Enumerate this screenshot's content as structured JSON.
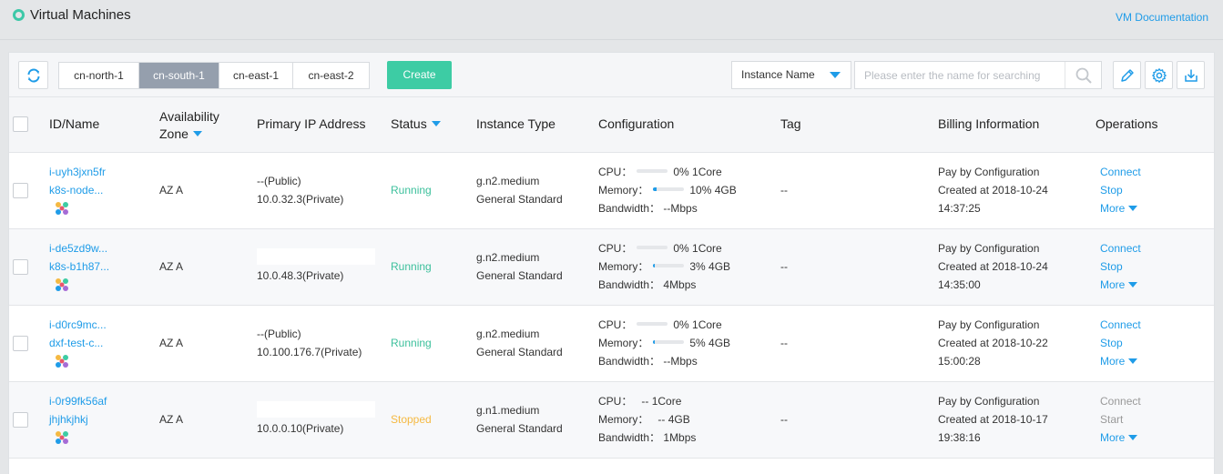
{
  "header": {
    "title": "Virtual Machines",
    "doc_link": "VM Documentation"
  },
  "toolbar": {
    "regions": [
      "cn-north-1",
      "cn-south-1",
      "cn-east-1",
      "cn-east-2"
    ],
    "active_region": "cn-south-1",
    "create_label": "Create",
    "search_type": "Instance Name",
    "search_placeholder": "Please enter the name for searching"
  },
  "table": {
    "columns": {
      "id_name": "ID/Name",
      "az_line1": "Availability",
      "az_line2": "Zone",
      "ip": "Primary IP Address",
      "status": "Status",
      "type": "Instance Type",
      "config": "Configuration",
      "tag": "Tag",
      "billing": "Billing Information",
      "ops": "Operations"
    },
    "rows": [
      {
        "id": "i-uyh3jxn5fr",
        "name": "k8s-node...",
        "az": "AZ A",
        "ip_public": "--(Public)",
        "ip_private": "10.0.32.3(Private)",
        "status": "Running",
        "type": "g.n2.medium",
        "family": "General Standard",
        "cpu_label": "CPU：",
        "cpu_value": "0%",
        "cpu_fraction": 0.0,
        "cpu_spec": "1Core",
        "mem_label": "Memory：",
        "mem_value": "10%",
        "mem_fraction": 0.1,
        "mem_spec": "4GB",
        "bw_label": "Bandwidth：",
        "bw_value": "--Mbps",
        "tag": "--",
        "billing": "Pay by Configuration",
        "created": "Created at 2018-10-24",
        "time": "14:37:25",
        "op1": "Connect",
        "op2": "Stop",
        "op3": "More"
      },
      {
        "id": "i-de5zd9w...",
        "name": "k8s-b1h87...",
        "az": "AZ A",
        "ip_public": "",
        "ip_private": "10.0.48.3(Private)",
        "status": "Running",
        "type": "g.n2.medium",
        "family": "General Standard",
        "cpu_label": "CPU：",
        "cpu_value": "0%",
        "cpu_fraction": 0.0,
        "cpu_spec": "1Core",
        "mem_label": "Memory：",
        "mem_value": "3%",
        "mem_fraction": 0.03,
        "mem_spec": "4GB",
        "bw_label": "Bandwidth：",
        "bw_value": "4Mbps",
        "tag": "--",
        "billing": "Pay by Configuration",
        "created": "Created at 2018-10-24",
        "time": "14:35:00",
        "op1": "Connect",
        "op2": "Stop",
        "op3": "More"
      },
      {
        "id": "i-d0rc9mc...",
        "name": "dxf-test-c...",
        "az": "AZ A",
        "ip_public": "--(Public)",
        "ip_private": "10.100.176.7(Private)",
        "status": "Running",
        "type": "g.n2.medium",
        "family": "General Standard",
        "cpu_label": "CPU：",
        "cpu_value": "0%",
        "cpu_fraction": 0.0,
        "cpu_spec": "1Core",
        "mem_label": "Memory：",
        "mem_value": "5%",
        "mem_fraction": 0.05,
        "mem_spec": "4GB",
        "bw_label": "Bandwidth：",
        "bw_value": "--Mbps",
        "tag": "--",
        "billing": "Pay by Configuration",
        "created": "Created at 2018-10-22",
        "time": "15:00:28",
        "op1": "Connect",
        "op2": "Stop",
        "op3": "More"
      },
      {
        "id": "i-0r99fk56af",
        "name": "jhjhkjhkj",
        "az": "AZ A",
        "ip_public": "",
        "ip_private": "10.0.0.10(Private)",
        "status": "Stopped",
        "type": "g.n1.medium",
        "family": "General Standard",
        "cpu_label": "CPU：",
        "cpu_value": "--",
        "cpu_spec": "1Core",
        "mem_label": "Memory：",
        "mem_value": "--",
        "mem_spec": "4GB",
        "bw_label": "Bandwidth：",
        "bw_value": "1Mbps",
        "tag": "--",
        "billing": "Pay by Configuration",
        "created": "Created at 2018-10-17",
        "time": "19:38:16",
        "op1": "Connect",
        "op2": "Start",
        "op3": "More"
      }
    ]
  },
  "colors": {
    "accent": "#1f9ce8",
    "create": "#3dcca4",
    "running": "#3dc09c",
    "stopped": "#f5b942",
    "active_region": "#959fad"
  }
}
